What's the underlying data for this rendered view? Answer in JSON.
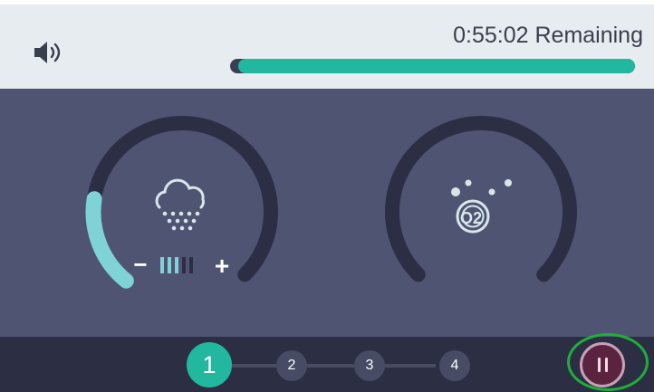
{
  "header": {
    "remaining_text": "0:55:02 Remaining",
    "progress_fraction_remaining": 0.98,
    "volume_icon": "speaker-volume-icon"
  },
  "knobs": [
    {
      "name": "mist-knob",
      "icon": "mist-cloud-icon",
      "level_fraction": 0.22,
      "decrease_label": "−",
      "increase_label": "+"
    },
    {
      "name": "oxygen-knob",
      "icon": "oxygen-bubbles-icon",
      "o2_text": "O2"
    }
  ],
  "steps": {
    "items": [
      "1",
      "2",
      "3",
      "4"
    ],
    "active_index": 0
  },
  "controls": {
    "pause_icon": "pause-icon"
  },
  "colors": {
    "accent": "#22b8a0",
    "knob_track": "#2c2f44",
    "knob_level": "#7fd3d6",
    "pause_bg": "#5a2440",
    "highlight": "#1fae3a"
  }
}
